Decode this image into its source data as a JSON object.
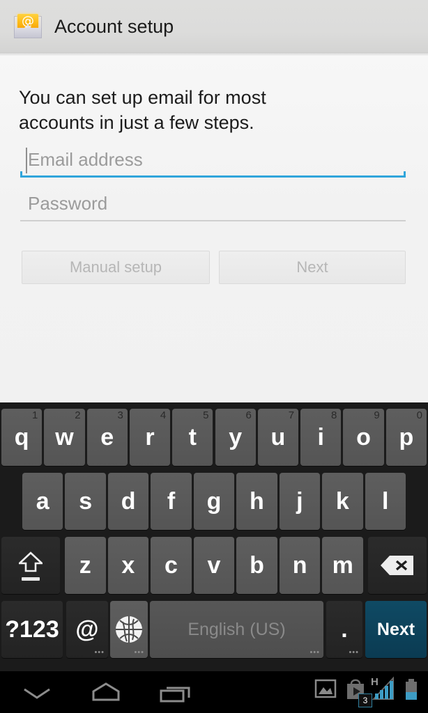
{
  "header": {
    "title": "Account setup",
    "icon": "email-envelope-at-icon",
    "at_symbol": "@"
  },
  "content": {
    "intro_text": "You can set up email for most accounts in just a few steps.",
    "email_field": {
      "name": "email-address-input",
      "placeholder": "Email address",
      "value": "",
      "focused": true,
      "underline_color": "#2fa5db"
    },
    "password_field": {
      "name": "password-input",
      "placeholder": "Password",
      "value": "",
      "focused": false,
      "underline_color": "#cfcfcf"
    },
    "buttons": {
      "manual_setup": "Manual setup",
      "next": "Next",
      "disabled": true
    }
  },
  "keyboard": {
    "row1": [
      {
        "label": "q",
        "hint": "1"
      },
      {
        "label": "w",
        "hint": "2"
      },
      {
        "label": "e",
        "hint": "3"
      },
      {
        "label": "r",
        "hint": "4"
      },
      {
        "label": "t",
        "hint": "5"
      },
      {
        "label": "y",
        "hint": "6"
      },
      {
        "label": "u",
        "hint": "7"
      },
      {
        "label": "i",
        "hint": "8"
      },
      {
        "label": "o",
        "hint": "9"
      },
      {
        "label": "p",
        "hint": "0"
      }
    ],
    "row2": [
      {
        "label": "a"
      },
      {
        "label": "s"
      },
      {
        "label": "d"
      },
      {
        "label": "f"
      },
      {
        "label": "g"
      },
      {
        "label": "h"
      },
      {
        "label": "j"
      },
      {
        "label": "k"
      },
      {
        "label": "l"
      }
    ],
    "row3": [
      {
        "label": "z"
      },
      {
        "label": "x"
      },
      {
        "label": "c"
      },
      {
        "label": "v"
      },
      {
        "label": "b"
      },
      {
        "label": "n"
      },
      {
        "label": "m"
      }
    ],
    "shift_key": {
      "name": "shift-key",
      "label": ""
    },
    "backspace_key": {
      "name": "backspace-key",
      "label": ""
    },
    "symbols_key": {
      "label": "?123"
    },
    "at_key": {
      "label": "@",
      "dots": "•••"
    },
    "language_key": {
      "label": "",
      "dots": "•••"
    },
    "space_key": {
      "label": "English (US)",
      "dots": "•••"
    },
    "period_key": {
      "label": ".",
      "dots": "•••"
    },
    "action_key": {
      "label": "Next",
      "color": "#0d4257"
    }
  },
  "navbar": {
    "back_label": "hide-keyboard",
    "home_label": "home",
    "recents_label": "recent-apps",
    "status": {
      "photo_icon": "image-icon",
      "play_icon": "play-store-icon",
      "play_badge": "3",
      "network_type": "H",
      "signal_bars": 4,
      "battery_label": "battery",
      "accent_color": "#3d9cc4"
    }
  }
}
